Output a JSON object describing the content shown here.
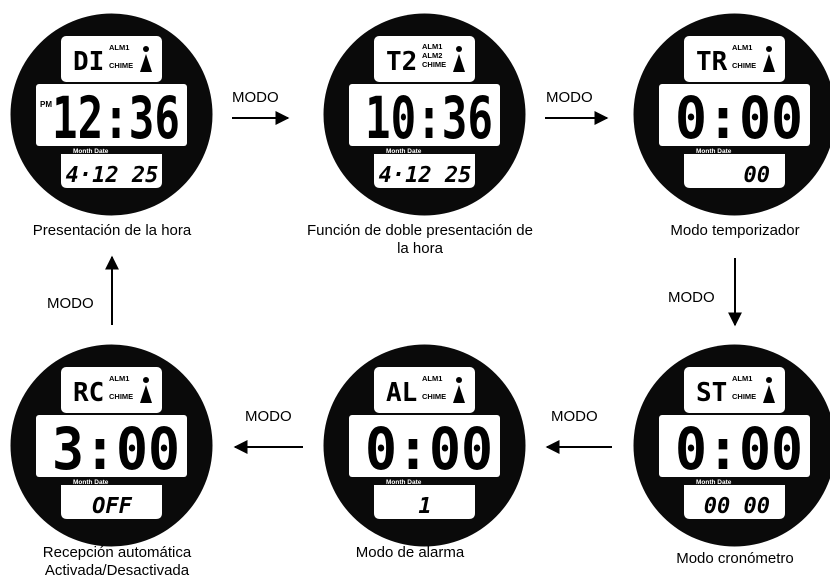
{
  "transition_label": "MODO",
  "watches": [
    {
      "id": "time",
      "mode_code": "DI",
      "indicators": [
        "ALM1",
        "CHIME"
      ],
      "pm": "PM",
      "main": "12:36",
      "sub_label": "Month Date",
      "bottom": "4·12 25",
      "caption": [
        "Presentación de la hora"
      ]
    },
    {
      "id": "dual",
      "mode_code": "T2",
      "indicators": [
        "ALM1",
        "ALM2",
        "CHIME"
      ],
      "pm": "",
      "main": "10:36",
      "sub_label": "Month Date",
      "bottom": "4·12 25",
      "caption": [
        "Función de doble presentación de",
        "la hora"
      ]
    },
    {
      "id": "timer",
      "mode_code": "TR",
      "indicators": [
        "ALM1",
        "CHIME"
      ],
      "pm": "",
      "main": "0:00",
      "sub_label": "Month Date",
      "bottom": "00",
      "caption": [
        "Modo temporizador"
      ]
    },
    {
      "id": "chrono",
      "mode_code": "ST",
      "indicators": [
        "ALM1",
        "CHIME"
      ],
      "pm": "",
      "main": "0:00",
      "sub_label": "Month Date",
      "bottom": "00 00",
      "caption": [
        "Modo cronómetro"
      ]
    },
    {
      "id": "alarm",
      "mode_code": "AL",
      "indicators": [
        "ALM1",
        "CHIME"
      ],
      "pm": "",
      "main": "0:00",
      "sub_label": "Month Date",
      "bottom": "1",
      "caption": [
        "Modo de alarma"
      ]
    },
    {
      "id": "reception",
      "mode_code": "RC",
      "indicators": [
        "ALM1",
        "CHIME"
      ],
      "pm": "",
      "main": "3:00",
      "sub_label": "Month Date",
      "bottom": "OFF",
      "caption": [
        "Recepción automática",
        "Activada/Desactivada"
      ]
    }
  ]
}
